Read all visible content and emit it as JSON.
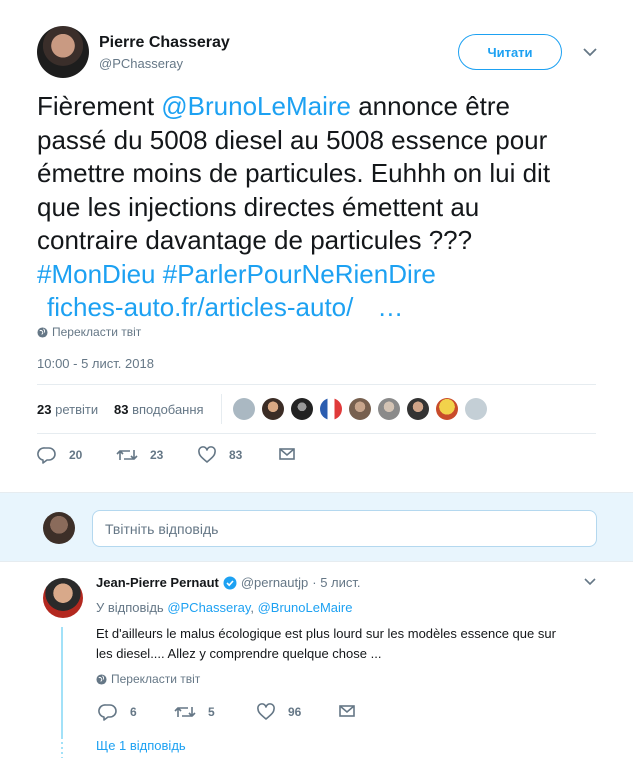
{
  "tweet": {
    "author_name": "Pierre Chasseray",
    "author_handle": "@PChasseray",
    "follow_label": "Читати",
    "text_prefix": "Fièrement ",
    "mention": "@BrunoLeMaire",
    "text_line1_rest": " annonce être",
    "text_line2": "passé du 5008 diesel au 5008 essence pour",
    "text_line3": "émettre moins de particules. Euhhh on lui dit",
    "text_line4": "que les injections directes émettent au",
    "text_line5": "contraire davantage de particules ???",
    "hashtag1": "#MonDieu",
    "hashtag2": "#ParlerPourNeRienDire",
    "link_text": "fiches-auto.fr/articles-auto/",
    "link_ellipsis": "…",
    "translate_label": "Перекласти твіт",
    "timestamp": "10:00 - 5 лист. 2018",
    "retweets_count": "23",
    "retweets_label": "ретвіти",
    "likes_count": "83",
    "likes_label": "вподобання",
    "replies_action": "20",
    "retweets_action": "23",
    "likes_action": "83"
  },
  "reply_box": {
    "placeholder": "Твітніть відповідь"
  },
  "reply": {
    "author_name": "Jean-Pierre Pernaut",
    "author_handle": "@pernautjp",
    "time": "· 5 лист.",
    "replying_to_label": "У відповідь",
    "replying_to_1": "@PChasseray",
    "replying_to_2": "@BrunoLeMaire",
    "text_line1": "Et d'ailleurs le malus écologique est plus lourd sur les modèles essence que sur",
    "text_line2": "les diesel.... Allez y comprendre quelque chose ...",
    "translate_label": "Перекласти твіт",
    "replies_action": "6",
    "retweets_action": "5",
    "likes_action": "96",
    "more_replies_label": "Ще 1 відповідь"
  },
  "colors": {
    "accent": "#1da1f2",
    "muted": "#657786",
    "text": "#14171a",
    "divider": "#e6ecf0",
    "thread_line": "#a2e1f8"
  },
  "icons": {
    "translate": "globe-icon",
    "reply": "reply-icon",
    "retweet": "retweet-icon",
    "like": "heart-icon",
    "dm": "envelope-icon",
    "more": "chevron-down-icon",
    "verified": "verified-badge-icon"
  }
}
